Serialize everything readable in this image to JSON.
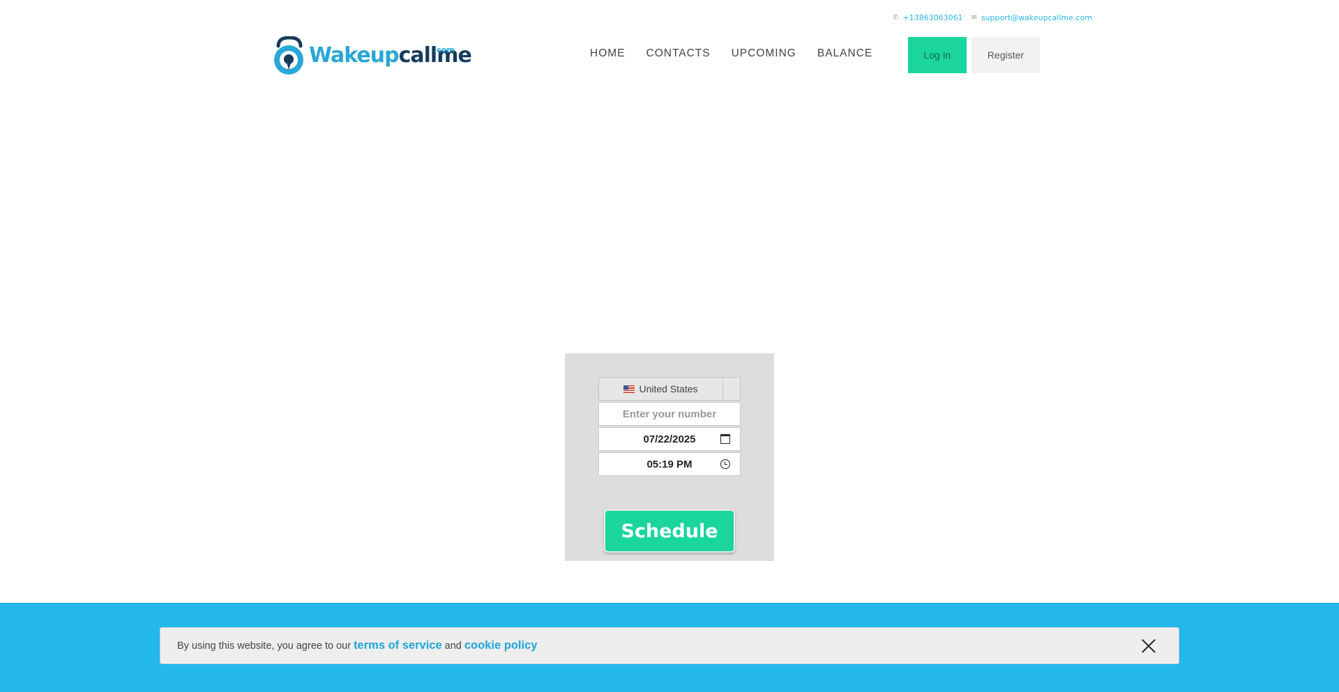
{
  "topbar": {
    "phone": "+13863063061",
    "email": "support@wakeupcallme.com"
  },
  "logo": {
    "part1": "Wakeup",
    "part2": "callme",
    "suffix": ".com",
    "icon": "alarm-clock-icon"
  },
  "nav": {
    "items": [
      "HOME",
      "CONTACTS",
      "UPCOMING",
      "BALANCE"
    ]
  },
  "auth": {
    "login_label": "Log In",
    "register_label": "Register"
  },
  "form": {
    "country": "United States",
    "country_flag": "us-flag-icon",
    "phone_placeholder": "Enter your number",
    "date_value": "07/22/2025",
    "time_value": "05:19 PM",
    "schedule_label": "Schedule"
  },
  "cookie": {
    "prefix": "By using this website, you agree to our",
    "terms_label": "terms of service",
    "and": "and",
    "cookie_label": "cookie policy"
  },
  "colors": {
    "accent_green": "#1ad69b",
    "footer_blue": "#23b7ec",
    "logo_blue": "#29a8d6",
    "logo_navy": "#163c5c"
  }
}
